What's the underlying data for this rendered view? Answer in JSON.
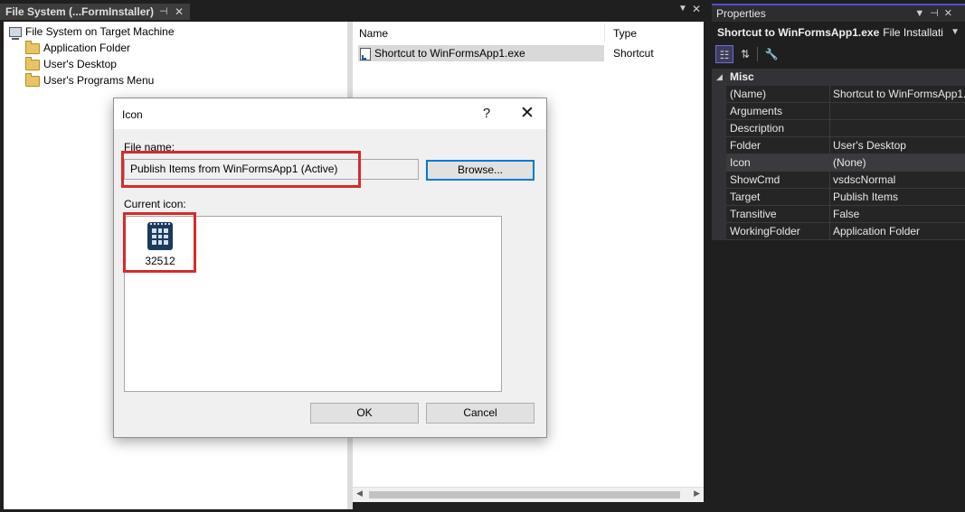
{
  "file_system": {
    "tab_title": "File System (...FormInstaller)",
    "tree": {
      "root": "File System on Target Machine",
      "items": [
        "Application Folder",
        "User's Desktop",
        "User's Programs Menu"
      ]
    },
    "list": {
      "columns": [
        "Name",
        "Type"
      ],
      "rows": [
        {
          "name": "Shortcut to WinFormsApp1.exe",
          "type": "Shortcut"
        }
      ]
    }
  },
  "properties": {
    "title": "Properties",
    "object_name": "Shortcut to WinFormsApp1.exe",
    "object_type": "File Installati",
    "category": "Misc",
    "rows": [
      {
        "name": "(Name)",
        "value": "Shortcut to WinFormsApp1.exe"
      },
      {
        "name": "Arguments",
        "value": ""
      },
      {
        "name": "Description",
        "value": ""
      },
      {
        "name": "Folder",
        "value": "User's Desktop"
      },
      {
        "name": "Icon",
        "value": "(None)"
      },
      {
        "name": "ShowCmd",
        "value": "vsdscNormal"
      },
      {
        "name": "Target",
        "value": "Publish Items"
      },
      {
        "name": "Transitive",
        "value": "False"
      },
      {
        "name": "WorkingFolder",
        "value": "Application Folder"
      }
    ]
  },
  "dialog": {
    "title": "Icon",
    "help_glyph": "?",
    "close_glyph": "✕",
    "file_name_label": "File name:",
    "file_name_value": "Publish Items from WinFormsApp1 (Active)",
    "browse_label": "Browse...",
    "current_icon_label": "Current icon:",
    "icons": [
      {
        "id": "32512"
      }
    ],
    "ok_label": "OK",
    "cancel_label": "Cancel"
  },
  "colors": {
    "highlight": "#d62b2b",
    "accent": "#0078d7",
    "dark_bg": "#1f1f1f"
  }
}
